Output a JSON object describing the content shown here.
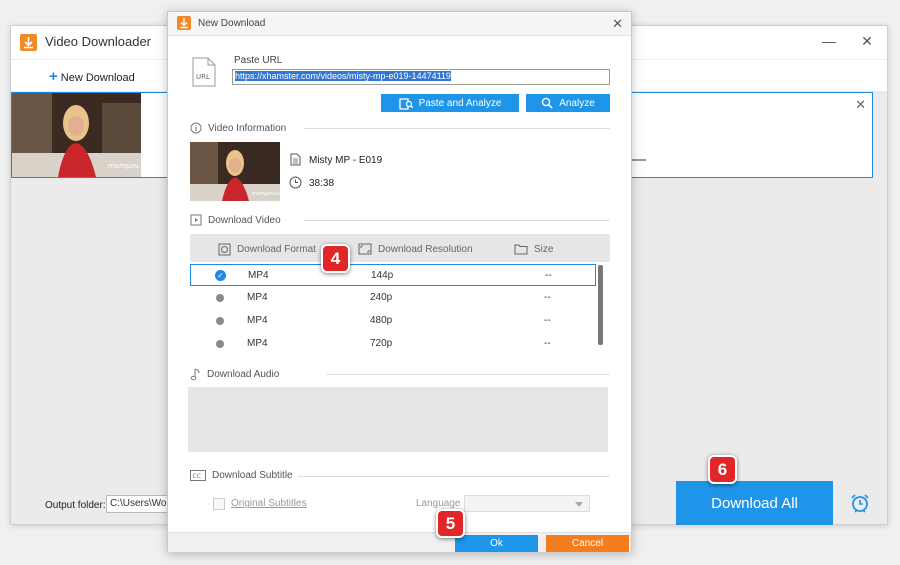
{
  "main_window": {
    "title": "Video Downloader",
    "new_download_label": "New Download",
    "output_folder_label": "Output folder:",
    "output_folder_value": "C:\\Users\\Wonde",
    "download_all_label": "Download All"
  },
  "dialog": {
    "title": "New Download",
    "paste_url_label": "Paste URL",
    "url_value": "https://xhamster.com/videos/misty-mp-e019-14474119",
    "paste_analyze_label": "Paste and Analyze",
    "analyze_label": "Analyze",
    "video_info": {
      "header": "Video Information",
      "title": "Misty MP - E019",
      "duration": "38:38"
    },
    "download_video": {
      "header": "Download Video",
      "columns": {
        "format": "Download Format",
        "resolution": "Download Resolution",
        "size": "Size"
      },
      "rows": [
        {
          "format": "MP4",
          "resolution": "144p",
          "size": "--",
          "selected": true
        },
        {
          "format": "MP4",
          "resolution": "240p",
          "size": "--",
          "selected": false
        },
        {
          "format": "MP4",
          "resolution": "480p",
          "size": "--",
          "selected": false
        },
        {
          "format": "MP4",
          "resolution": "720p",
          "size": "--",
          "selected": false
        }
      ]
    },
    "download_audio": {
      "header": "Download Audio"
    },
    "download_subtitle": {
      "header": "Download Subtitle",
      "original_subtitles_label": "Original Subtitles",
      "language_label": "Language"
    },
    "ok_label": "Ok",
    "cancel_label": "Cancel"
  },
  "badges": {
    "step4": "4",
    "step5": "5",
    "step6": "6"
  },
  "colors": {
    "accent_blue": "#1e95e8",
    "cancel_orange": "#f47d20",
    "badge_red": "#e02626",
    "logo_orange": "#f08a24"
  }
}
